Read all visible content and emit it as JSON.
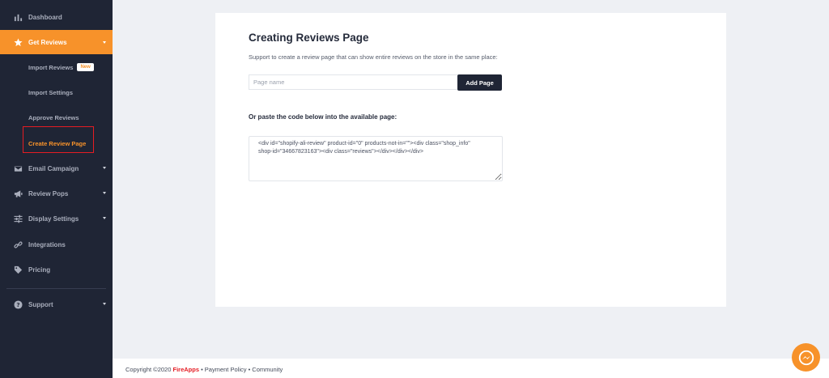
{
  "sidebar": {
    "items": [
      {
        "label": "Dashboard",
        "icon": "bar-chart-icon"
      },
      {
        "label": "Get Reviews",
        "icon": "star-icon",
        "active": true
      },
      {
        "label": "Email Campaign",
        "icon": "envelope-icon"
      },
      {
        "label": "Review Pops",
        "icon": "megaphone-icon"
      },
      {
        "label": "Display Settings",
        "icon": "sliders-icon"
      },
      {
        "label": "Integrations",
        "icon": "link-icon"
      },
      {
        "label": "Pricing",
        "icon": "tag-icon"
      },
      {
        "label": "Support",
        "icon": "question-icon"
      }
    ],
    "sub_items": [
      {
        "label": "Import Reviews",
        "badge": "New"
      },
      {
        "label": "Import Settings"
      },
      {
        "label": "Approve Reviews"
      },
      {
        "label": "Create Review Page",
        "current": true
      }
    ]
  },
  "main": {
    "title": "Creating Reviews Page",
    "description": "Support to create a review page that can show entire reviews on the store in the same place:",
    "input_placeholder": "Page name",
    "add_button": "Add Page",
    "code_label": "Or paste the code below into the available page:",
    "code_line1": "<div id=\"shopify-ali-review\" product-id=\"0\" products-not-in=\"\"><div class=\"shop_info\"",
    "code_line2": "shop-id=\"34667823163\"><div class=\"reviews\"></div></div></div>"
  },
  "footer": {
    "copyright": "Copyright ©2020 ",
    "brand": "FireApps",
    "sep1": " • ",
    "payment_policy": "Payment Policy",
    "sep2": " • ",
    "community": "Community"
  },
  "colors": {
    "sidebar_bg": "#1f2535",
    "accent": "#f7922a",
    "highlight": "#e51c23",
    "brand_red": "#e51c23"
  }
}
